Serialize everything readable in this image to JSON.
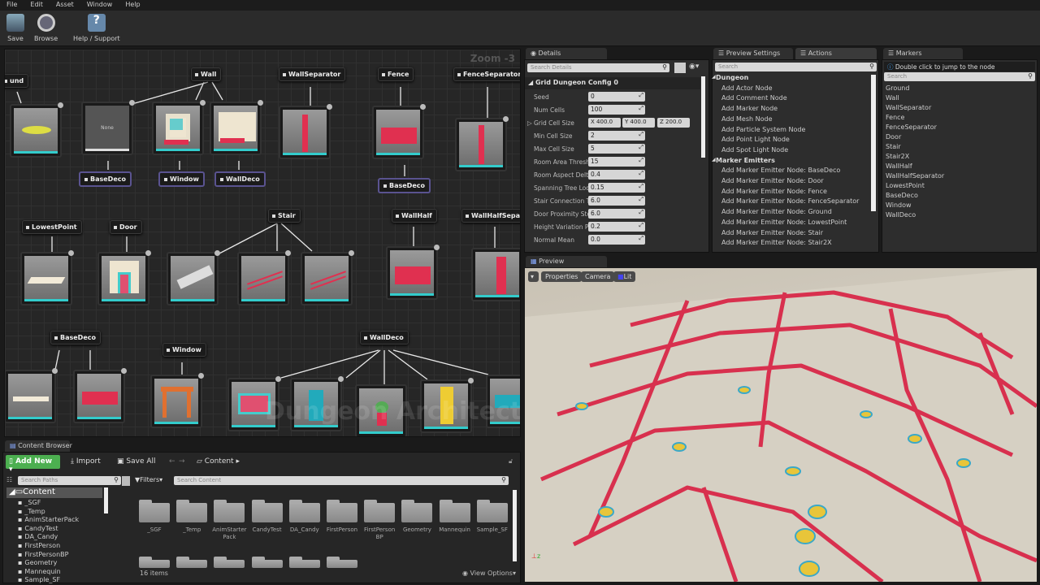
{
  "menu": [
    "File",
    "Edit",
    "Asset",
    "Window",
    "Help"
  ],
  "toolbar": {
    "save": "Save",
    "browse": "Browse",
    "help": "Help / Support"
  },
  "graph": {
    "zoom": "Zoom -3",
    "markers": {
      "ground": "und",
      "wall": "Wall",
      "wall_separator": "WallSeparator",
      "fence": "Fence",
      "fence_separator": "FenceSeparator",
      "lowest_point": "LowestPoint",
      "door": "Door",
      "stair": "Stair",
      "wall_half": "WallHalf",
      "wall_half_separator": "WallHalfSeparat",
      "base_deco": "BaseDeco",
      "window": "Window",
      "wall_deco": "WallDeco"
    },
    "emitters": [
      "BaseDeco",
      "Window",
      "WallDeco",
      "BaseDeco"
    ],
    "none_label": "None",
    "watermark": "Dungeon Architect"
  },
  "details": {
    "tab": "Details",
    "search_placeholder": "Search Details",
    "section": "Grid Dungeon Config 0",
    "props": [
      {
        "label": "Seed",
        "value": "0"
      },
      {
        "label": "Num Cells",
        "value": "100"
      },
      {
        "label": "Grid Cell Size",
        "x": "400.0",
        "y": "400.0",
        "z": "200.0"
      },
      {
        "label": "Min Cell Size",
        "value": "2"
      },
      {
        "label": "Max Cell Size",
        "value": "5"
      },
      {
        "label": "Room Area Threshold",
        "value": "15"
      },
      {
        "label": "Room Aspect Delta",
        "value": "0.4"
      },
      {
        "label": "Spanning Tree Loop",
        "value": "0.15"
      },
      {
        "label": "Stair Connection Tolerance",
        "value": "6.0"
      },
      {
        "label": "Door Proximity Steps",
        "value": "6.0"
      },
      {
        "label": "Height Variation Probability",
        "value": "0.2"
      },
      {
        "label": "Normal Mean",
        "value": "0.0"
      }
    ]
  },
  "actions": {
    "tabs": [
      "Preview Settings",
      "Actions"
    ],
    "search_placeholder": "Search",
    "categories": [
      {
        "name": "Dungeon",
        "items": [
          "Add Actor Node",
          "Add Comment Node",
          "Add Marker Node",
          "Add Mesh Node",
          "Add Particle System Node",
          "Add Point Light Node",
          "Add Spot Light Node"
        ]
      },
      {
        "name": "Marker Emitters",
        "items": [
          "Add Marker Emitter Node: BaseDeco",
          "Add Marker Emitter Node: Door",
          "Add Marker Emitter Node: Fence",
          "Add Marker Emitter Node: FenceSeparator",
          "Add Marker Emitter Node: Ground",
          "Add Marker Emitter Node: LowestPoint",
          "Add Marker Emitter Node: Stair",
          "Add Marker Emitter Node: Stair2X"
        ]
      }
    ]
  },
  "markers": {
    "tab": "Markers",
    "hint": "Double click to jump to the node",
    "search_placeholder": "Search",
    "items": [
      "Ground",
      "Wall",
      "WallSeparator",
      "Fence",
      "FenceSeparator",
      "Door",
      "Stair",
      "Stair2X",
      "WallHalf",
      "WallHalfSeparator",
      "LowestPoint",
      "BaseDeco",
      "Window",
      "WallDeco"
    ]
  },
  "preview": {
    "tab": "Preview",
    "properties": "Properties",
    "camera": "Camera",
    "lit": "Lit"
  },
  "content_browser": {
    "tab": "Content Browser",
    "add_new": "Add New",
    "import": "Import",
    "save_all": "Save All",
    "path": "Content",
    "search_paths_placeholder": "Search Paths",
    "filters": "Filters",
    "search_content_placeholder": "Search Content",
    "tree_root": "Content",
    "tree": [
      "_SGF",
      "_Temp",
      "AnimStarterPack",
      "CandyTest",
      "DA_Candy",
      "FirstPerson",
      "FirstPersonBP",
      "Geometry",
      "Mannequin",
      "Sample_SF"
    ],
    "folders": [
      "_SGF",
      "_Temp",
      "AnimStarter Pack",
      "CandyTest",
      "DA_Candy",
      "FirstPerson",
      "FirstPerson BP",
      "Geometry",
      "Mannequin",
      "Sample_SF"
    ],
    "item_count": "16 items",
    "view_options": "View Options"
  },
  "colors": {
    "accent_green": "#4caf50",
    "wall_red": "#e03050",
    "teal": "#33cccc",
    "emitter_border": "#5a5390"
  }
}
